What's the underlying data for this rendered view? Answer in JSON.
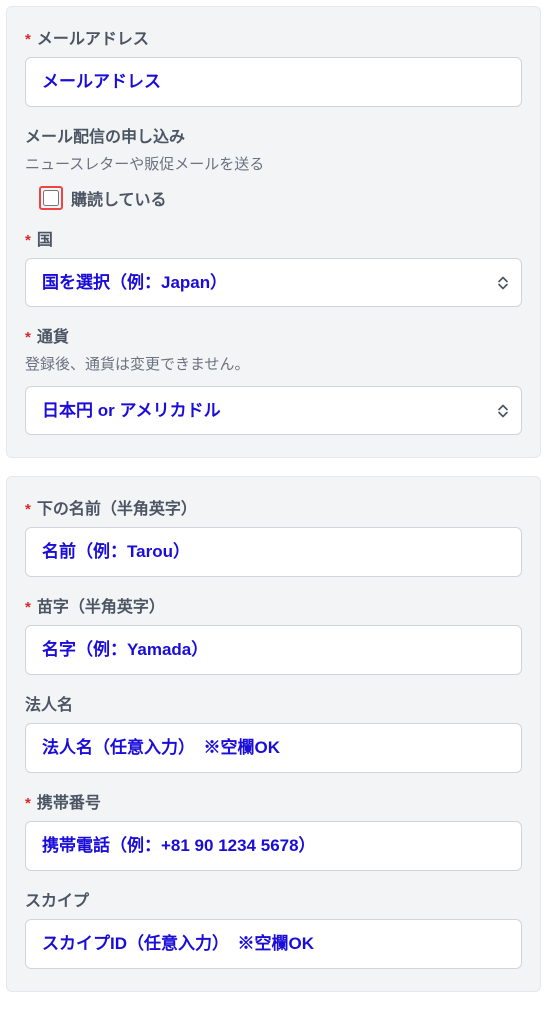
{
  "panel1": {
    "email": {
      "required": "*",
      "label": "メールアドレス",
      "placeholder": "メールアドレス"
    },
    "newsletter": {
      "label": "メール配信の申し込み",
      "helper": "ニュースレターや販促メールを送る",
      "checkbox_label": "購読している"
    },
    "country": {
      "required": "*",
      "label": "国",
      "placeholder": "国を選択（例：Japan）"
    },
    "currency": {
      "required": "*",
      "label": "通貨",
      "helper": "登録後、通貨は変更できません。",
      "placeholder": "日本円 or アメリカドル"
    }
  },
  "panel2": {
    "first_name": {
      "required": "*",
      "label": "下の名前（半角英字）",
      "placeholder": "名前（例：Tarou）"
    },
    "last_name": {
      "required": "*",
      "label": "苗字（半角英字）",
      "placeholder": "名字（例：Yamada）"
    },
    "company": {
      "label": "法人名",
      "placeholder": "法人名（任意入力）　※空欄OK"
    },
    "phone": {
      "required": "*",
      "label": "携帯番号",
      "placeholder": "携帯電話（例：+81 90 1234 5678）"
    },
    "skype": {
      "label": "スカイプ",
      "placeholder": "スカイプID（任意入力）　※空欄OK"
    }
  }
}
